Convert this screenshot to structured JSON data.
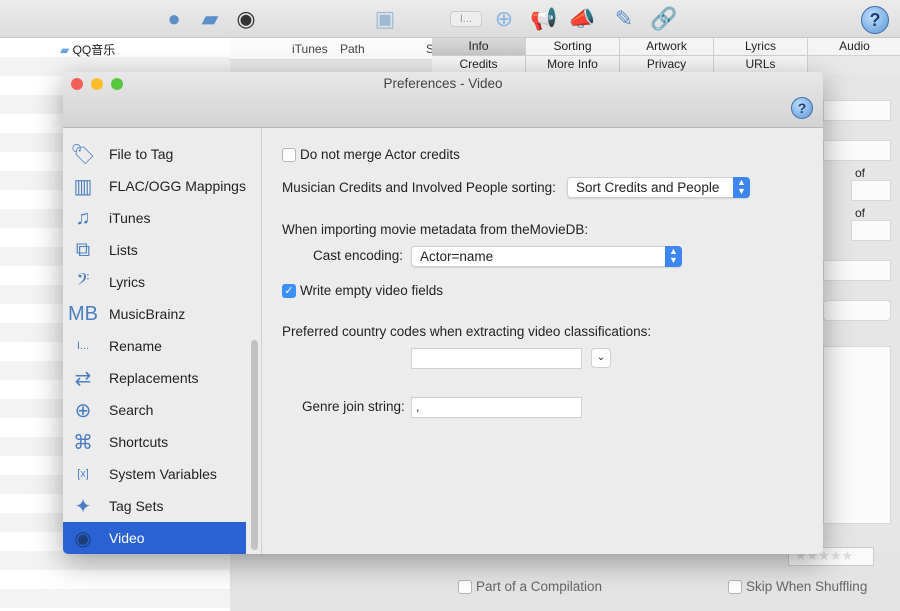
{
  "app": {
    "toolbar_icons": [
      "globe-icon",
      "folder-icon",
      "cd-icon",
      "save-icon",
      "rename-icon",
      "search-icon",
      "megaphone-icon",
      "megaphone-edit-icon",
      "pencil-icon",
      "link-icon",
      "help-icon"
    ],
    "folder_item": "QQ音乐",
    "columns": [
      "iTunes",
      "Path",
      "S"
    ],
    "tabs_row1": [
      "Info",
      "Sorting",
      "Artwork",
      "Lyrics",
      "Audio"
    ],
    "tabs_row2": [
      "Credits",
      "More Info",
      "Privacy",
      "URLs"
    ],
    "selected_tab": "Info",
    "of_label_1": "of",
    "of_label_2": "of",
    "bottom": {
      "compilation": "Part of a Compilation",
      "skip_shuffling": "Skip When Shuffling",
      "rating": "★★★★★"
    }
  },
  "dialog": {
    "title": "Preferences - Video",
    "sidebar": {
      "items": [
        {
          "label": "File to Tag",
          "icon": "file-tag-icon",
          "glyph": "🏷"
        },
        {
          "label": "FLAC/OGG Mappings",
          "icon": "equalizer-icon",
          "glyph": "▥"
        },
        {
          "label": "iTunes",
          "icon": "music-note-icon",
          "glyph": "♫"
        },
        {
          "label": "Lists",
          "icon": "lists-icon",
          "glyph": "⧉"
        },
        {
          "label": "Lyrics",
          "icon": "bass-clef-icon",
          "glyph": "𝄢"
        },
        {
          "label": "MusicBrainz",
          "icon": "musicbrainz-icon",
          "glyph": "MB"
        },
        {
          "label": "Rename",
          "icon": "rename-icon",
          "glyph": "I..."
        },
        {
          "label": "Replacements",
          "icon": "arrows-swap-icon",
          "glyph": "⇄"
        },
        {
          "label": "Search",
          "icon": "search-icon",
          "glyph": "⊕"
        },
        {
          "label": "Shortcuts",
          "icon": "command-icon",
          "glyph": "⌘"
        },
        {
          "label": "System Variables",
          "icon": "variables-icon",
          "glyph": "[x]"
        },
        {
          "label": "Tag Sets",
          "icon": "puzzle-icon",
          "glyph": "✦"
        },
        {
          "label": "Video",
          "icon": "camera-icon",
          "glyph": "◉"
        }
      ],
      "selected": "Video"
    },
    "form": {
      "no_merge_actor": {
        "label": "Do not merge Actor credits",
        "checked": false
      },
      "musician_sort_label": "Musician Credits and Involved People sorting:",
      "musician_sort_value": "Sort Credits and People",
      "import_heading": "When importing movie metadata from theMovieDB:",
      "cast_encoding_label": "Cast encoding:",
      "cast_encoding_value": "Actor=name",
      "write_empty": {
        "label": "Write empty video fields",
        "checked": true
      },
      "country_codes_label": "Preferred country codes when extracting video classifications:",
      "country_codes_value": "",
      "genre_join_label": "Genre join string:",
      "genre_join_value": ","
    }
  },
  "colors": {
    "accent": "#2a62d4",
    "checkbox": "#3b8ff6"
  }
}
